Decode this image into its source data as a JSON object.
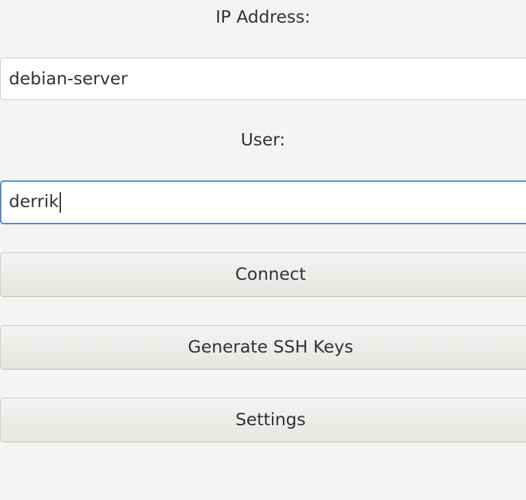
{
  "ip_label": "IP Address:",
  "ip_value": "debian-server",
  "user_label": "User:",
  "user_value": "derrik",
  "buttons": {
    "connect": "Connect",
    "generate_keys": "Generate SSH Keys",
    "settings": "Settings"
  },
  "colors": {
    "focus": "#4a86cf",
    "background": "#f5f4f2"
  }
}
